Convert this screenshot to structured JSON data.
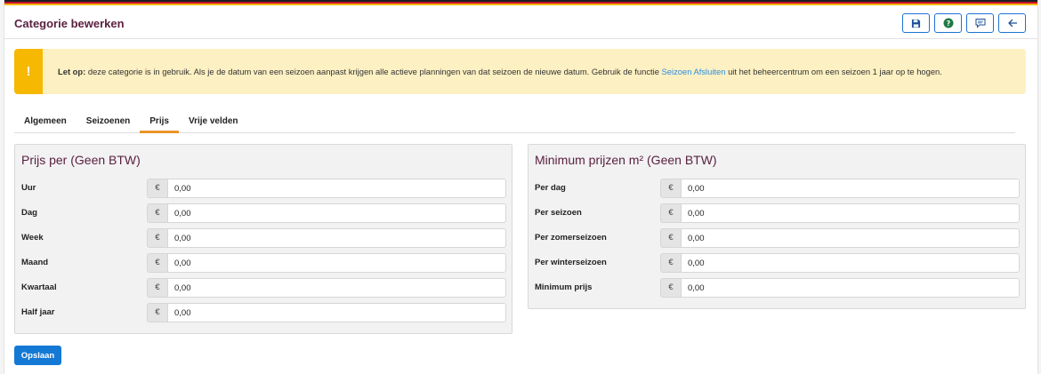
{
  "header": {
    "title": "Categorie bewerken",
    "toolbar": [
      {
        "icon": "save-icon"
      },
      {
        "icon": "help-icon"
      },
      {
        "icon": "comment-icon"
      },
      {
        "icon": "back-arrow-icon"
      }
    ]
  },
  "colors": {
    "accent": "#1479d4",
    "title": "#5a2140",
    "alert_bg": "#fdf0c2",
    "alert_side": "#f6b800",
    "tab_active": "#e8962a"
  },
  "alert": {
    "icon": "!",
    "prefix": "Let op:",
    "text_before": " deze categorie is in gebruik. Als je de datum van een seizoen aanpast krijgen alle actieve planningen van dat seizoen de nieuwe datum. Gebruik de functie ",
    "link": "Seizoen Afsluiten",
    "text_after": " uit het beheercentrum om een seizoen 1 jaar op te hogen."
  },
  "tabs": [
    {
      "label": "Algemeen",
      "active": false
    },
    {
      "label": "Seizoenen",
      "active": false
    },
    {
      "label": "Prijs",
      "active": true
    },
    {
      "label": "Vrije velden",
      "active": false
    }
  ],
  "prices": {
    "title": "Prijs per (Geen BTW)",
    "currency": "€",
    "rows": [
      {
        "label": "Uur",
        "value": "0,00"
      },
      {
        "label": "Dag",
        "value": "0,00"
      },
      {
        "label": "Week",
        "value": "0,00"
      },
      {
        "label": "Maand",
        "value": "0,00"
      },
      {
        "label": "Kwartaal",
        "value": "0,00"
      },
      {
        "label": "Half jaar",
        "value": "0,00"
      }
    ]
  },
  "minimum_prices": {
    "title": "Minimum prijzen m² (Geen BTW)",
    "currency": "€",
    "rows": [
      {
        "label": "Per dag",
        "value": "0,00"
      },
      {
        "label": "Per seizoen",
        "value": "0,00"
      },
      {
        "label": "Per zomerseizoen",
        "value": "0,00"
      },
      {
        "label": "Per winterseizoen",
        "value": "0,00"
      },
      {
        "label": "Minimum prijs",
        "value": "0,00"
      }
    ]
  },
  "save_button": "Opslaan"
}
